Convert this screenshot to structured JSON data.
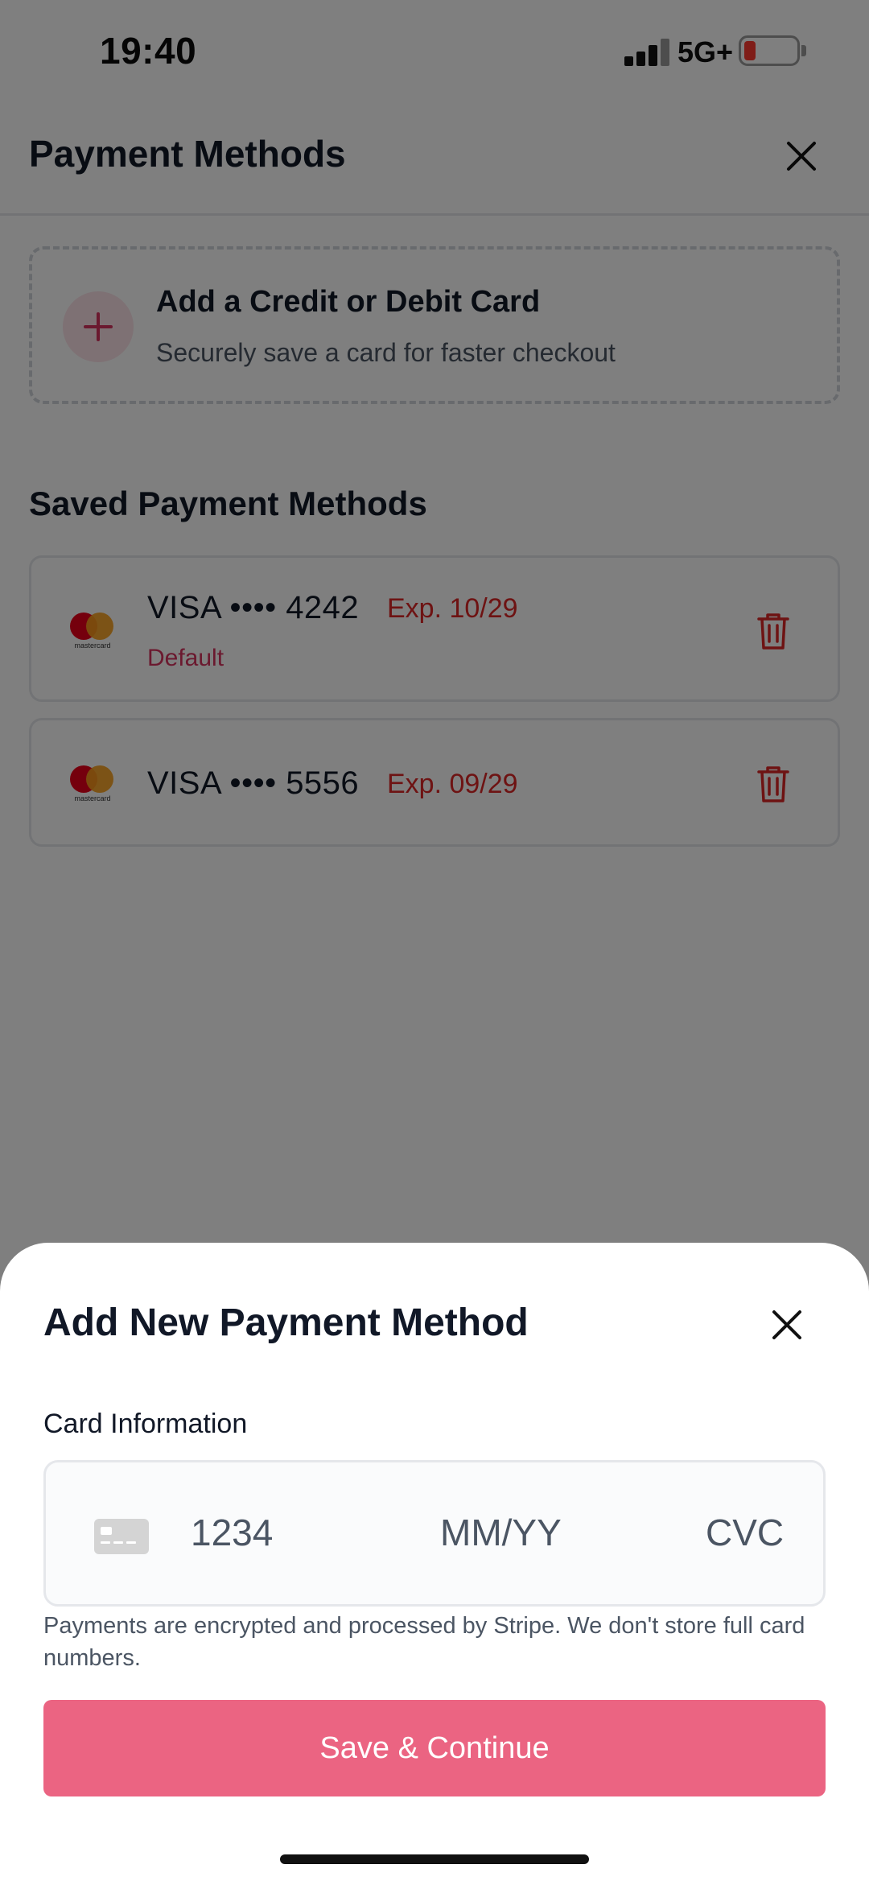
{
  "status_bar": {
    "time": "19:40",
    "network": "5G+"
  },
  "header": {
    "title": "Payment Methods",
    "close_icon": "close-icon"
  },
  "add_card": {
    "title": "Add a Credit or Debit Card",
    "subtitle": "Securely save a card for faster checkout",
    "icon": "plus-icon"
  },
  "saved": {
    "heading": "Saved Payment Methods",
    "cards": [
      {
        "number": "VISA •••• 4242",
        "expiry": "Exp. 10/29",
        "badge": "Default",
        "logo_text": "mastercard"
      },
      {
        "number": "VISA •••• 5556",
        "expiry": "Exp. 09/29",
        "logo_text": "mastercard"
      }
    ]
  },
  "sheet": {
    "title": "Add New Payment Method",
    "field_label": "Card Information",
    "card_number_placeholder": "1234",
    "expiry_placeholder": "MM/YY",
    "cvc_placeholder": "CVC",
    "note": "Payments are encrypted and processed by Stripe. We don't store full card numbers.",
    "button_label": "Save & Continue"
  },
  "colors": {
    "accent": "#eb6482",
    "danger": "#dc2626",
    "overlay": "rgba(0,0,0,0.5)"
  }
}
